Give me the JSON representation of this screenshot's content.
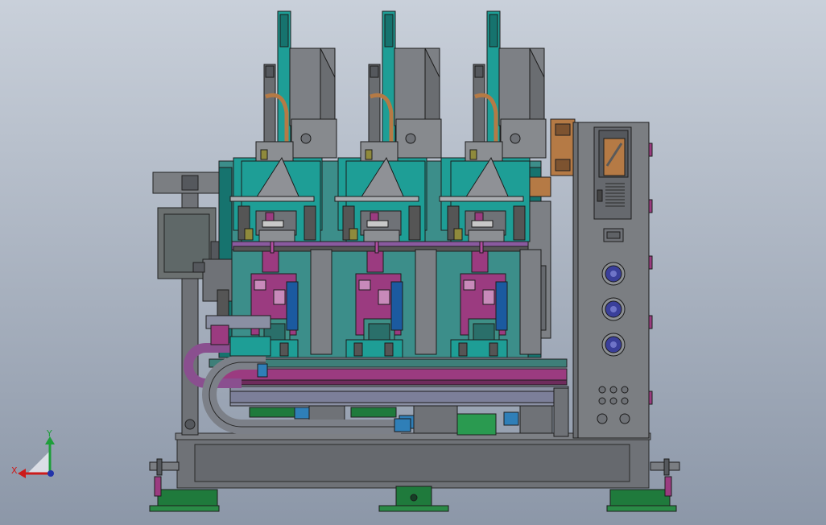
{
  "viewport": {
    "background_top": "#c9d0da",
    "background_bottom": "#8c97a8"
  },
  "triad": {
    "x_label": "X",
    "y_label": "Y",
    "x_color": "#cc1b1b",
    "y_color": "#1e9e3a",
    "z_color": "#2233aa"
  },
  "colors": {
    "frame": "#6f7277",
    "frame_dark": "#55585d",
    "teal": "#1e9e96",
    "teal_dark": "#16736e",
    "magenta": "#9b3b80",
    "purple": "#8a5a9f",
    "olive": "#8f8a3c",
    "green": "#1f7a3c",
    "blue": "#2f7fb8",
    "copper": "#b57a45",
    "grey_block": "#8c8f93",
    "cabinet": "#7b7e82",
    "fan": "#3a3f9a"
  }
}
